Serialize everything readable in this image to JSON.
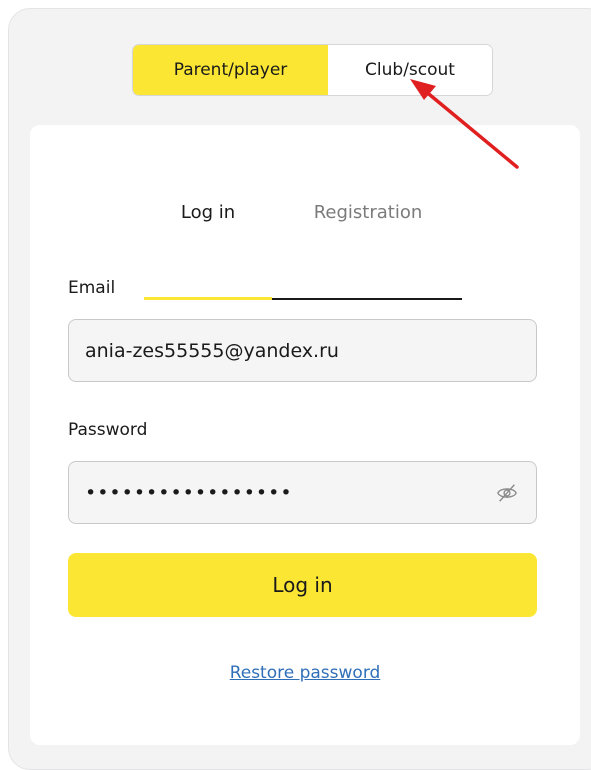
{
  "role_toggle": {
    "active_label": "Parent/player",
    "inactive_label": "Club/scout"
  },
  "tabs": {
    "login": "Log in",
    "registration": "Registration"
  },
  "form": {
    "email_label": "Email",
    "email_value": "ania-zes55555@yandex.ru",
    "password_label": "Password",
    "password_mask": "•••••••••••••••••"
  },
  "actions": {
    "login_button": "Log in",
    "restore_link": "Restore password"
  },
  "colors": {
    "accent_yellow": "#fbe733",
    "link_blue": "#2f6fb8",
    "annotation_red": "#e02020"
  },
  "icons": {
    "password_toggle": "eye-slash-icon",
    "annotation": "red-arrow"
  }
}
